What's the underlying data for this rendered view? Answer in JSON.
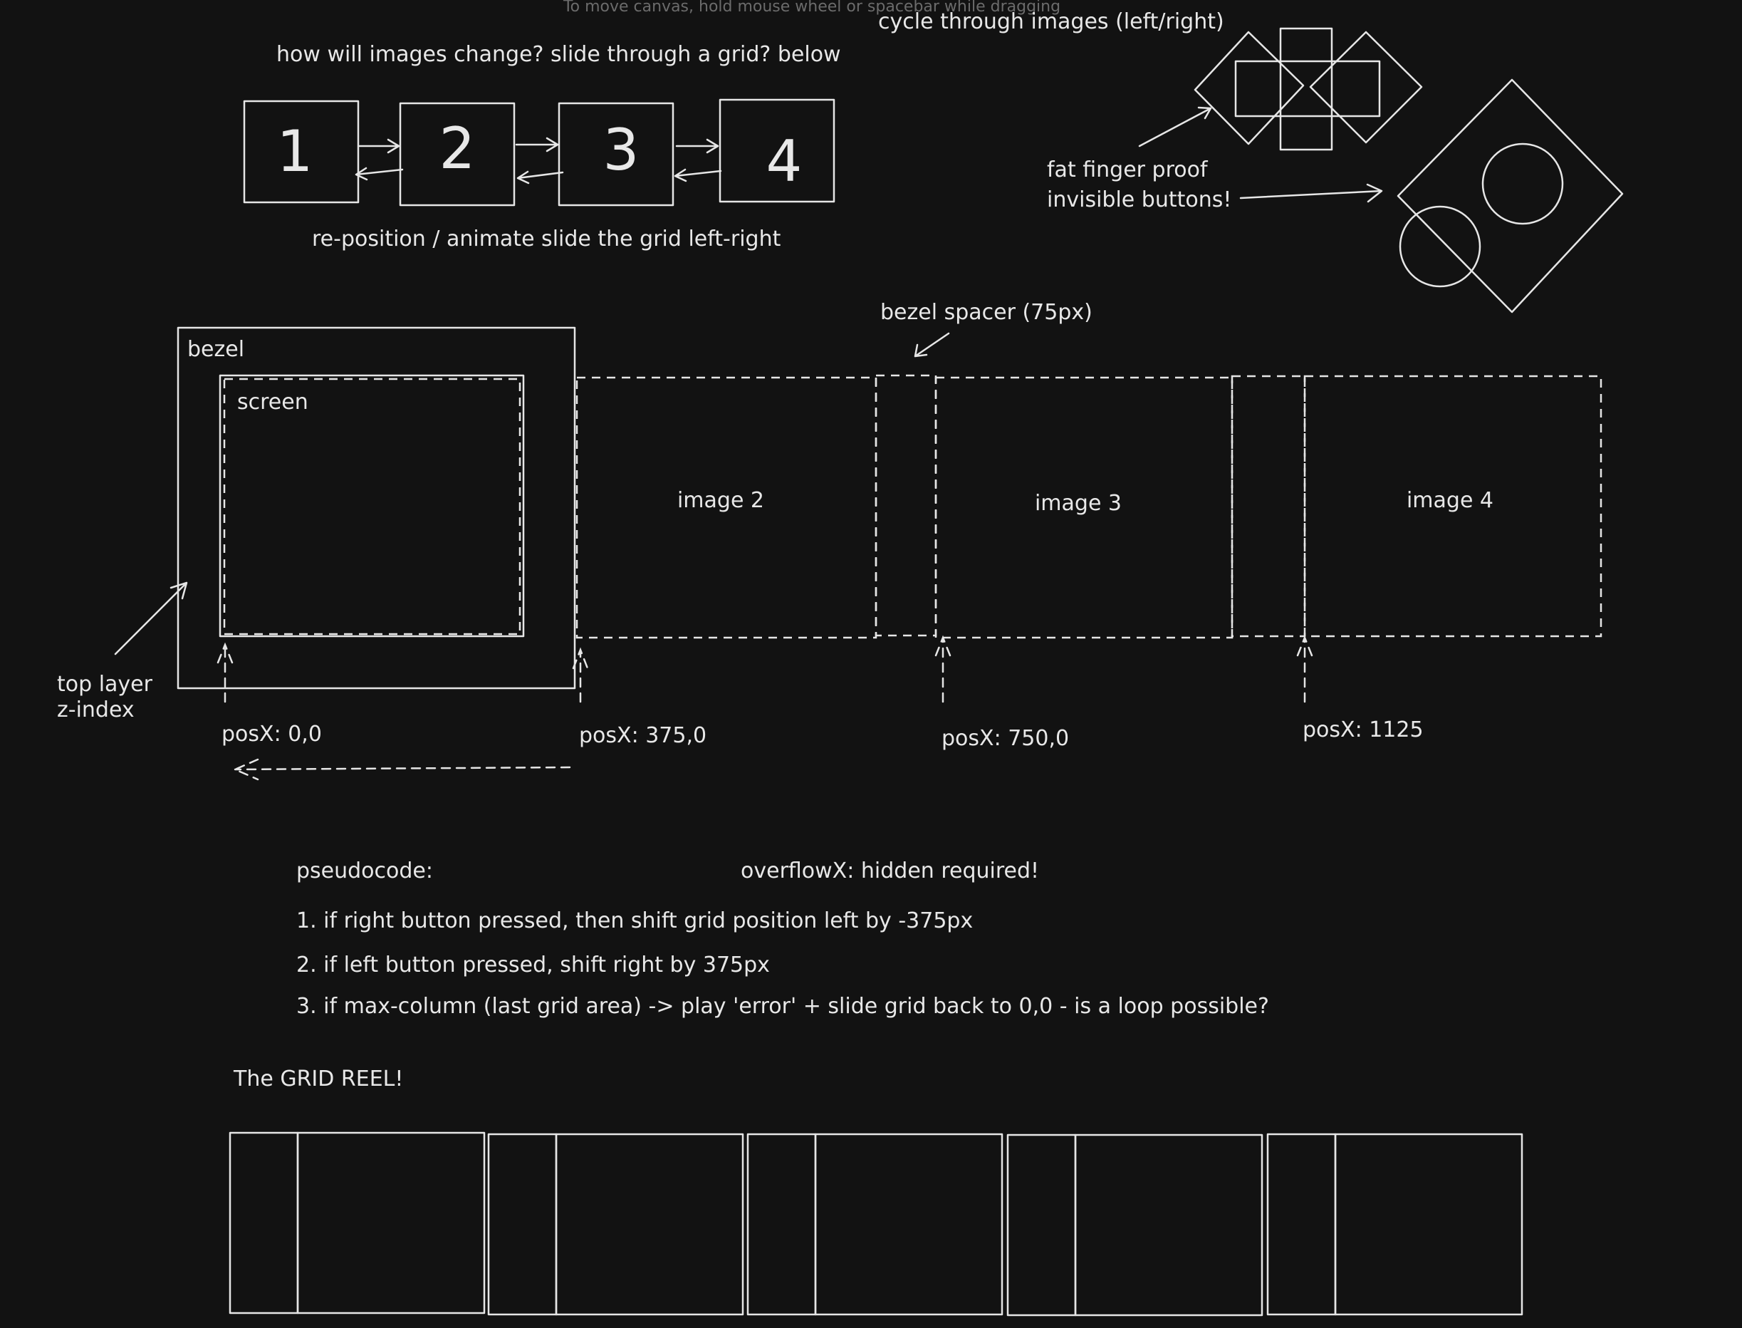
{
  "canvas_hint": "To move canvas, hold mouse wheel or spacebar while dragging",
  "top_section": {
    "question": "how will images change? slide through a grid? below",
    "slides": [
      "1",
      "2",
      "3",
      "4"
    ],
    "caption": "re-position / animate slide the grid left-right"
  },
  "buttons_section": {
    "title": "cycle through images (left/right)",
    "note_line1": "fat finger proof",
    "note_line2": "invisible buttons!"
  },
  "layout_section": {
    "bezel_label": "bezel",
    "screen_label": "screen",
    "spacer_label": "bezel spacer (75px)",
    "images": [
      "image 2",
      "image 3",
      "image 4"
    ],
    "top_layer_line1": "top layer",
    "top_layer_line2": "z-index",
    "positions": [
      "posX: 0,0",
      "posX: 375,0",
      "posX: 750,0",
      "posX: 1125"
    ]
  },
  "pseudocode": {
    "heading": "pseudocode:",
    "overflow_note": "overflowX: hidden required!",
    "steps": [
      "1. if right button pressed, then shift grid position left by -375px",
      "2. if left button pressed, shift right by 375px",
      "3. if max-column (last grid area) -> play 'error' + slide grid back to 0,0 - is a loop possible?"
    ]
  },
  "reel": {
    "title": "The GRID REEL!"
  },
  "colors": {
    "background": "#121212",
    "stroke": "#e6e6e6",
    "hint_text": "#6b6b6b"
  }
}
